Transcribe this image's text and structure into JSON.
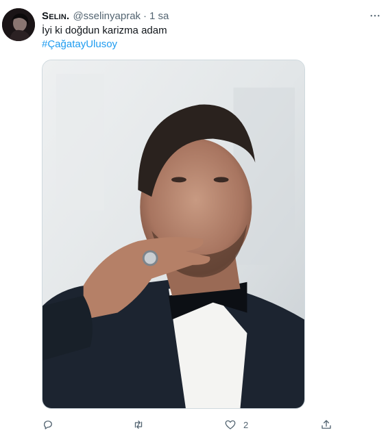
{
  "tweet": {
    "display_name": "Selin.",
    "handle": "@sselinyaprak",
    "separator": "·",
    "time": "1 sa",
    "text": "İyi ki doğdun karizma adam",
    "hashtag": "#ÇağatayUlusoy",
    "media_alt": "photo",
    "actions": {
      "reply_count": "",
      "retweet_count": "",
      "like_count": "2",
      "share_count": ""
    },
    "icons": {
      "more": "more-horizontal-icon",
      "reply": "reply-icon",
      "retweet": "retweet-icon",
      "like": "heart-icon",
      "share": "share-icon"
    },
    "colors": {
      "link": "#1d9bf0",
      "secondary": "#536471",
      "primary": "#0f1419"
    }
  }
}
